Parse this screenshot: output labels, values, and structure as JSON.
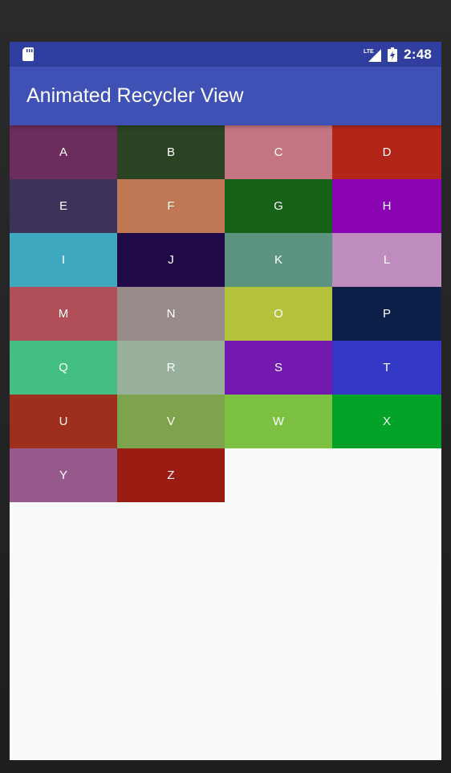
{
  "status_bar": {
    "time": "2:48",
    "network_icon_label": "LTE",
    "icons": [
      "sd-card-icon",
      "lte-signal-icon",
      "battery-charging-icon"
    ]
  },
  "app_bar": {
    "title": "Animated Recycler View"
  },
  "colors": {
    "status_bar": "#303f9f",
    "app_bar": "#3f51b5",
    "background": "#fafafa"
  },
  "tiles": [
    {
      "label": "A",
      "color": "#6b2d5b"
    },
    {
      "label": "B",
      "color": "#2a4322"
    },
    {
      "label": "C",
      "color": "#c47581"
    },
    {
      "label": "D",
      "color": "#b22618"
    },
    {
      "label": "E",
      "color": "#3d335a"
    },
    {
      "label": "F",
      "color": "#c07854"
    },
    {
      "label": "G",
      "color": "#166219"
    },
    {
      "label": "H",
      "color": "#8b04b3"
    },
    {
      "label": "I",
      "color": "#3fa8c1"
    },
    {
      "label": "J",
      "color": "#1f0a47"
    },
    {
      "label": "K",
      "color": "#5c9381"
    },
    {
      "label": "L",
      "color": "#be8cbd"
    },
    {
      "label": "M",
      "color": "#b04f58"
    },
    {
      "label": "N",
      "color": "#988b89"
    },
    {
      "label": "O",
      "color": "#b4c13a"
    },
    {
      "label": "P",
      "color": "#0c1f49"
    },
    {
      "label": "Q",
      "color": "#43bf84"
    },
    {
      "label": "R",
      "color": "#98b09c"
    },
    {
      "label": "S",
      "color": "#7319b0"
    },
    {
      "label": "T",
      "color": "#3339c4"
    },
    {
      "label": "U",
      "color": "#9e2f1d"
    },
    {
      "label": "V",
      "color": "#7da44d"
    },
    {
      "label": "W",
      "color": "#7cc141"
    },
    {
      "label": "X",
      "color": "#02a128"
    },
    {
      "label": "Y",
      "color": "#975a8c"
    },
    {
      "label": "Z",
      "color": "#9b1c12"
    }
  ]
}
